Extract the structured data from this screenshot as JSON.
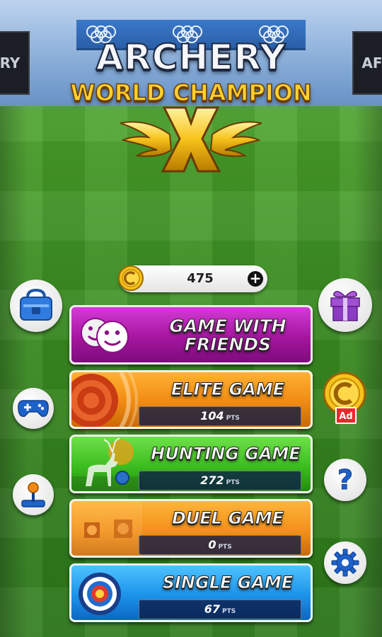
{
  "logo": {
    "title": "ARCHERY",
    "subtitle": "WORLD CHAMPION",
    "emblem": "X"
  },
  "scene": {
    "side_board_left": "RY",
    "side_board_right": "AF"
  },
  "coins": {
    "value": "475",
    "plus_label": "+",
    "icon": "coin-icon"
  },
  "modes": [
    {
      "key": "friends",
      "title_line1": "GAME WITH",
      "title_line2": "FRIENDS",
      "icon": "smiley-faces-icon"
    },
    {
      "key": "elite",
      "title": "ELITE GAME",
      "points": "104",
      "unit": "PTS",
      "icon": "target-icon"
    },
    {
      "key": "hunting",
      "title": "HUNTING GAME",
      "points": "272",
      "unit": "PTS",
      "icon": "deer-icon"
    },
    {
      "key": "duel",
      "title": "DUEL GAME",
      "points": "0",
      "unit": "PTS",
      "icon": "duel-target-icon"
    },
    {
      "key": "single",
      "title": "SINGLE GAME",
      "points": "67",
      "unit": "PTS",
      "icon": "bullseye-icon"
    }
  ],
  "side_buttons": {
    "left": [
      "bag-icon",
      "gamepad-icon",
      "joystick-icon"
    ],
    "right": [
      "gift-icon",
      "coin-ad-icon",
      "help-icon",
      "settings-icon"
    ],
    "ad_label": "Ad",
    "help_label": "?"
  },
  "colors": {
    "friends": "#a5169f",
    "elite": "#f08a12",
    "hunting": "#3cbd1f",
    "duel": "#f3901a",
    "single": "#1c93ea",
    "gold": "#ffcf2e"
  }
}
